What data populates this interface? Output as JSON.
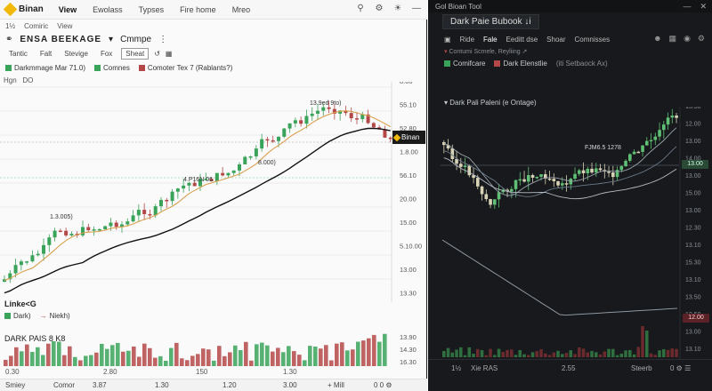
{
  "left": {
    "app_name": "Binan",
    "menu": [
      "View",
      "Ewolass",
      "Typses",
      "Fire home",
      "Mreo"
    ],
    "active_menu": "View",
    "subbar": [
      "1½",
      "Comiric",
      "View"
    ],
    "title": {
      "symbol": "ENSA BEEKAGE",
      "extra": "Cmmpe"
    },
    "toolbar2": [
      "Tantic",
      "Falt",
      "Stevige",
      "Fox",
      "Sheat"
    ],
    "toolbar2_selected": "Sheat",
    "legend": [
      {
        "label": "Darkmmage Mar 71.0)",
        "color": "#3aa35a"
      },
      {
        "label": "Comnes",
        "color": "#3aa35a"
      },
      {
        "label": "Comoter Tex 7 (Rablants?)",
        "color": "#b44848"
      }
    ],
    "hl_label": "Hgn",
    "hl_value": "DO",
    "chart_annotations": [
      "13.9ed 9to)",
      "8.000)",
      "1.3.005)",
      "4.P16N 06"
    ],
    "price_axis": [
      "8.00",
      "55.10",
      "52.80",
      "1.8.00",
      "56.10",
      "20.00",
      "15.00",
      "5.10.00",
      "13.00",
      "13.30"
    ],
    "price_pill": "Binan",
    "sub_legend_title": "Linke<G",
    "sub_legend": [
      {
        "label": "Dark)",
        "color": "#3aa35a"
      },
      {
        "label": "Niekh)",
        "color": "#b44848"
      }
    ],
    "volume_title": "DARK PAIS 8 K8",
    "volume_axis": [
      "13.90",
      "14.30",
      "16.30"
    ],
    "x_axis": [
      "0.30",
      "2.80",
      "150",
      "1.30"
    ],
    "status": [
      "Smiey",
      "Comor",
      "3.87",
      "1.30",
      "1.20",
      "3.00",
      "+ Mill",
      "0 0 ⚙"
    ]
  },
  "right": {
    "window_title": "Gol Bioan Tool",
    "tab": "Dark Paie Bubook ↓i",
    "toolbar": [
      "Ride",
      "Fale",
      "Eeditt dse",
      "Shoar",
      "Comnisses"
    ],
    "toolbar_selected": "Fale",
    "info1": "Contumi Scmele, Reyliing ↗",
    "info2": [
      {
        "label": "Comifcare",
        "color": "#3aa35a"
      },
      {
        "label": "Dark Elenstlie",
        "color": "#b44848"
      },
      {
        "label": "(iti Setbaock Ax)",
        "color": ""
      }
    ],
    "sub_title": "Dark Pali Paleni (e Ontage)",
    "annotation": "FJM6.5 1278",
    "price_axis": [
      "13.30",
      "12.00",
      "13.00",
      "14.00",
      "13.00",
      "15.00",
      "13.00",
      "12.30",
      "13.10",
      "15.30",
      "13.10",
      "13.50",
      "12.50",
      "13.00",
      "13.10"
    ],
    "price_tag_green": "13.00",
    "price_tag_red": "12.00",
    "status": [
      "1½",
      "Xie RAS",
      "2.55",
      "Steerb",
      "0 ⚙ ☰"
    ]
  },
  "colors": {
    "up": "#3aa35a",
    "down": "#b44848",
    "ma_fast": "#d9a050",
    "ma_slow": "#111111",
    "accent": "#f0b90b",
    "dark_bg": "#17191c"
  },
  "icons": [
    "search-icon",
    "gear-icon",
    "bell-icon",
    "minimize-icon",
    "close-icon"
  ]
}
